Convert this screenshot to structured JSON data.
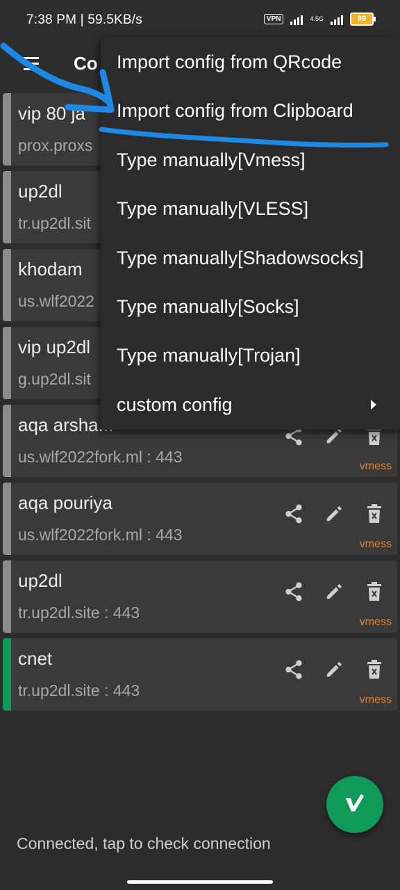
{
  "status": {
    "time": "7:38 PM | 59.5KB/s",
    "vpn": "VPN",
    "network": "4.5G",
    "battery": "89"
  },
  "toolbar": {
    "title": "Co"
  },
  "servers": [
    {
      "name": "vip 80 ja",
      "address": "prox.proxs",
      "type": ""
    },
    {
      "name": "up2dl",
      "address": "tr.up2dl.sit",
      "type": ""
    },
    {
      "name": "khodam",
      "address": "us.wlf2022",
      "type": ""
    },
    {
      "name": "vip up2dl",
      "address": "g.up2dl.sit",
      "type": ""
    },
    {
      "name": "aqa arsha...",
      "address": "us.wlf2022fork.ml : 443",
      "type": "vmess"
    },
    {
      "name": "aqa pouriya",
      "address": "us.wlf2022fork.ml : 443",
      "type": "vmess"
    },
    {
      "name": "up2dl",
      "address": "tr.up2dl.site : 443",
      "type": "vmess"
    },
    {
      "name": "cnet",
      "address": "tr.up2dl.site : 443",
      "type": "vmess"
    }
  ],
  "menu": {
    "items": [
      "Import config from QRcode",
      "Import config from Clipboard",
      "Type manually[Vmess]",
      "Type manually[VLESS]",
      "Type manually[Shadowsocks]",
      "Type manually[Socks]",
      "Type manually[Trojan]",
      "custom config"
    ]
  },
  "bottom": {
    "status_text": "Connected, tap to check connection"
  },
  "colors": {
    "accent": "#109a5a",
    "protocol": "#e0822e",
    "annotation": "#1e88e5"
  },
  "icons": {
    "share": "share-icon",
    "edit": "edit-icon",
    "delete": "delete-icon",
    "fab": "v-logo-icon"
  }
}
